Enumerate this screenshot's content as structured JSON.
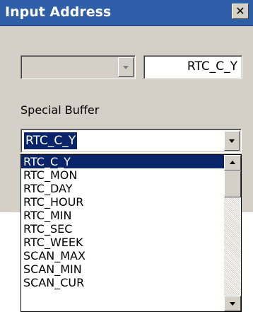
{
  "window": {
    "title": "Input Address",
    "close_glyph": "✕",
    "icons": {
      "close": "close-icon",
      "dropdown": "chevron-down-icon"
    }
  },
  "address": {
    "value": "RTC_C_Y"
  },
  "special_buffer": {
    "label": "Special Buffer",
    "selected_value": "RTC_C_Y",
    "options": [
      "RTC_C_Y",
      "RTC_MON",
      "RTC_DAY",
      "RTC_HOUR",
      "RTC_MIN",
      "RTC_SEC",
      "RTC_WEEK",
      "SCAN_MAX",
      "SCAN_MIN",
      "SCAN_CUR"
    ],
    "highlighted_index": 0
  },
  "colors": {
    "title_bar": "#2f5ea8",
    "selection": "#0a246a",
    "dialog_bg": "#d4d0c8"
  }
}
